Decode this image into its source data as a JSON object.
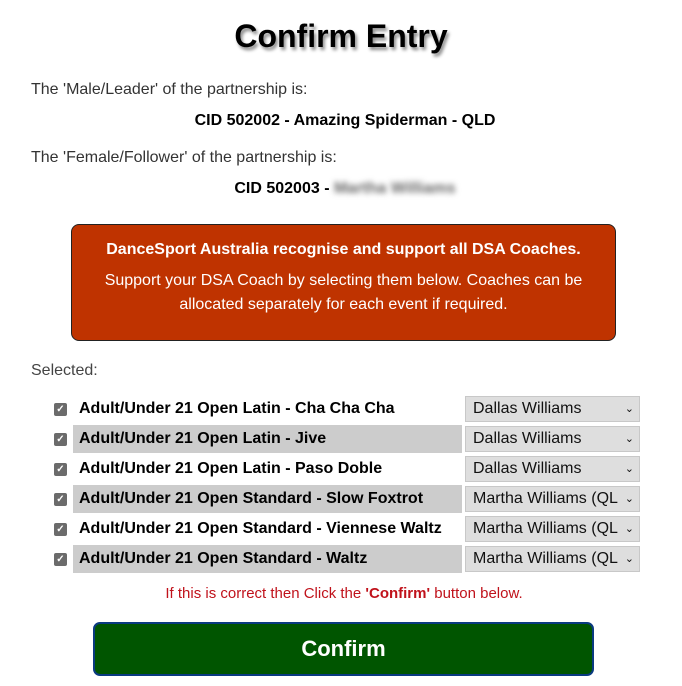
{
  "page": {
    "title": "Confirm Entry"
  },
  "partnership": {
    "leader_label": "The 'Male/Leader' of the partnership is:",
    "leader_value": "CID 502002 - Amazing Spiderman - QLD",
    "follower_label": "The 'Female/Follower' of the partnership is:",
    "follower_prefix": "CID 502003 - ",
    "follower_name_redacted": "Martha Williams"
  },
  "notice": {
    "heading": "DanceSport Australia recognise and support all DSA Coaches.",
    "body": "Support your DSA Coach by selecting them below. Coaches can be allocated separately for each event if required.",
    "background_color": "#bf3300"
  },
  "selection": {
    "label": "Selected:",
    "events": [
      {
        "name": "Adult/Under 21 Open Latin - Cha Cha Cha",
        "checked": true,
        "coach": "Dallas Williams"
      },
      {
        "name": "Adult/Under 21 Open Latin - Jive",
        "checked": true,
        "coach": "Dallas Williams"
      },
      {
        "name": "Adult/Under 21 Open Latin - Paso Doble",
        "checked": true,
        "coach": "Dallas Williams"
      },
      {
        "name": "Adult/Under 21 Open Standard - Slow Foxtrot",
        "checked": true,
        "coach": "Martha Williams (QL"
      },
      {
        "name": "Adult/Under 21 Open Standard - Viennese Waltz",
        "checked": true,
        "coach": "Martha Williams (QL"
      },
      {
        "name": "Adult/Under 21 Open Standard - Waltz",
        "checked": true,
        "coach": "Martha Williams (QL"
      }
    ]
  },
  "footer": {
    "instruction_prefix": "If this is correct then Click the ",
    "instruction_emphasis": "'Confirm'",
    "instruction_suffix": " button below.",
    "confirm_label": "Confirm",
    "confirm_color": "#005500"
  },
  "icons": {
    "checkbox_checked": "✓",
    "dropdown_chevron": "⌄"
  }
}
